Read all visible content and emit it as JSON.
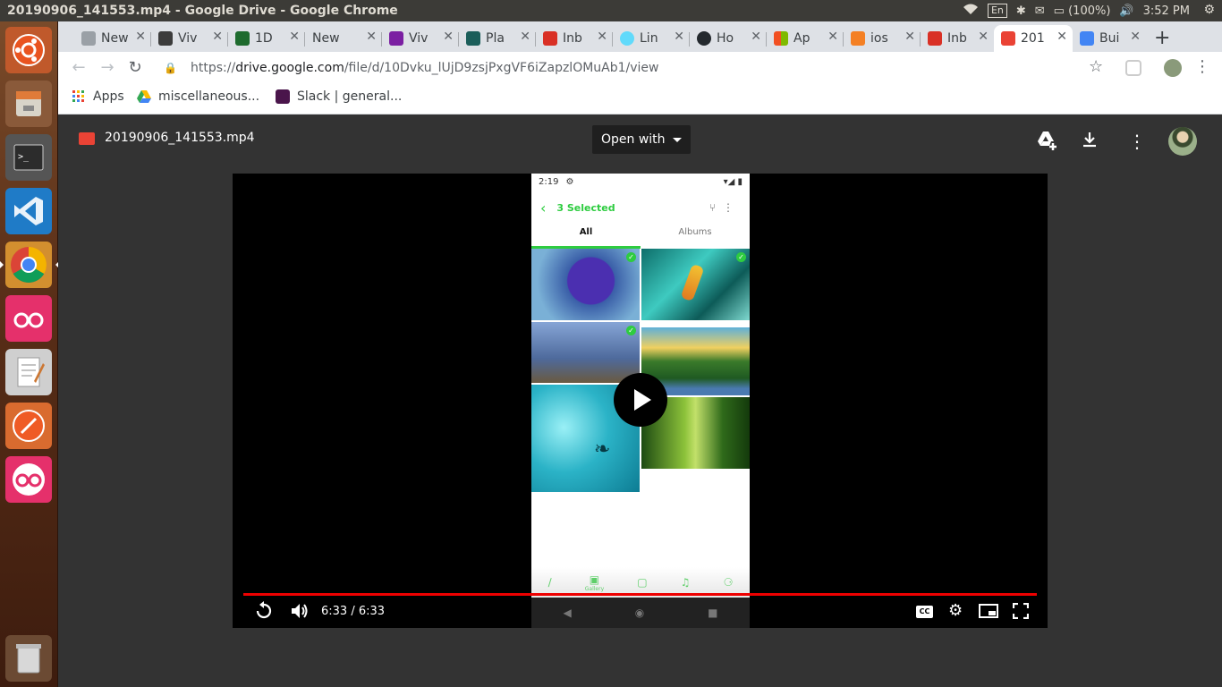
{
  "top_panel": {
    "window_title": "20190906_141553.mp4 - Google Drive - Google Chrome",
    "keyboard": "En",
    "battery": "(100%)",
    "clock": "3:52 PM"
  },
  "tabs": [
    {
      "title": "New Ta",
      "favicon_color": "#9aa0a6"
    },
    {
      "title": "Viv",
      "favicon_color": "#3c3c3c"
    },
    {
      "title": "1D",
      "favicon_color": "#1e6b2e"
    },
    {
      "title": "New Ta",
      "favicon_color": "#9aa0a6"
    },
    {
      "title": "Viv",
      "favicon_color": "#7b1fa2"
    },
    {
      "title": "Pla",
      "favicon_color": "#1b5e5a"
    },
    {
      "title": "Inb",
      "favicon_color": "#d93025"
    },
    {
      "title": "Lin",
      "favicon_color": "#61dafb"
    },
    {
      "title": "Ho",
      "favicon_color": "#24292e"
    },
    {
      "title": "Ap",
      "favicon_color": "#f25022"
    },
    {
      "title": "ios",
      "favicon_color": "#f48024"
    },
    {
      "title": "Inb",
      "favicon_color": "#d93025"
    },
    {
      "title": "201",
      "favicon_color": "#ea4335"
    },
    {
      "title": "Bui",
      "favicon_color": "#4285f4"
    }
  ],
  "omnibox": {
    "scheme": "https://",
    "host": "drive.google.com",
    "path": "/file/d/10Dvku_lUjD9zsjPxgVF6iZapzlOMuAb1/view"
  },
  "bookmarks": {
    "apps": "Apps",
    "misc": "miscellaneous...",
    "slack": "Slack | general..."
  },
  "viewer": {
    "file_name": "20190906_141553.mp4",
    "open_with": "Open with"
  },
  "phone": {
    "status_time": "2:19",
    "selected": "3 Selected",
    "tab_all": "All",
    "tab_albums": "Albums",
    "nav_gallery": "Gallery"
  },
  "player": {
    "time": "6:33 / 6:33",
    "cc": "CC",
    "progress": 1.0
  },
  "accent_color": "#ff0000"
}
